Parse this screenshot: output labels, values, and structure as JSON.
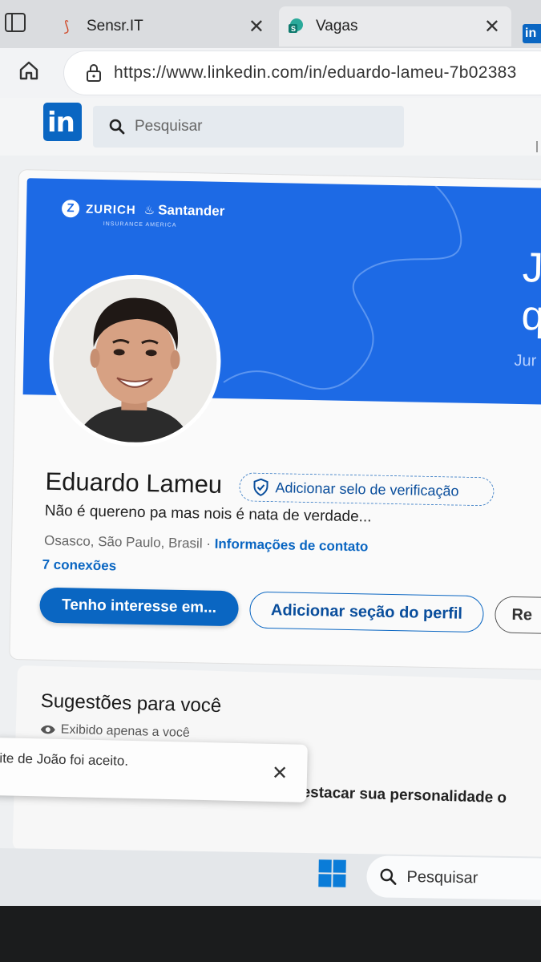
{
  "browser": {
    "tabs": [
      {
        "title": "Sensr.IT",
        "close": "✕"
      },
      {
        "title": "Vagas",
        "close": "✕"
      }
    ],
    "url": "https://www.linkedin.com/in/eduardo-lameu-7b02383"
  },
  "linkedin": {
    "logo": "in",
    "search_placeholder": "Pesquisar"
  },
  "banner": {
    "brand_zurich": "ZURICH",
    "brand_santander": "Santander",
    "brand_sub": "INSURANCE AMERICA",
    "text_line1": "J",
    "text_line2": "q",
    "text_line3": "Jur",
    "accent_color": "#1d6ae5"
  },
  "profile": {
    "name": "Eduardo Lameu",
    "verify_label": "Adicionar selo de verificação",
    "headline": "Não é quereno pa mas nois é nata de verdade...",
    "location": "Osasco, São Paulo, Brasil · ",
    "contact_info": "Informações de contato",
    "connections": "7 conexões",
    "btn_interest": "Tenho interesse em...",
    "btn_add_section": "Adicionar seção do perfil",
    "btn_more": "Re"
  },
  "suggestions": {
    "title": "Sugestões para você",
    "visibility": "Exibido apenas a você",
    "item_text": "Escreva um resumo para destacar sua personalidade o"
  },
  "toast": {
    "text": "ite de João foi aceito.",
    "close": "✕"
  },
  "taskbar": {
    "search_placeholder": "Pesquisar"
  }
}
